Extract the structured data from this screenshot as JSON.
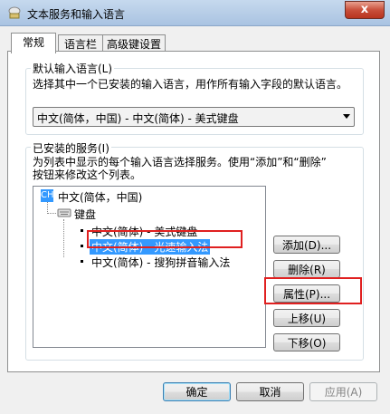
{
  "window": {
    "title": "文本服务和输入语言",
    "close_label": "x"
  },
  "tabs": [
    {
      "label": "常规",
      "active": true
    },
    {
      "label": "语言栏",
      "active": false
    },
    {
      "label": "高级键设置",
      "active": false
    }
  ],
  "default_language": {
    "group_label": "默认输入语言(L)",
    "description": "选择其中一个已安装的输入语言，用作所有输入字段的默认语言。",
    "selected": "中文(简体，中国) - 中文(简体) - 美式键盘"
  },
  "installed_services": {
    "group_label": "已安装的服务(I)",
    "description_line1": "为列表中显示的每个输入语言选择服务。使用“添加”和“删除”",
    "description_line2": "按钮来修改这个列表。",
    "tree": {
      "language_badge": "CH",
      "language": "中文(简体，中国)",
      "category": "键盘",
      "items": [
        {
          "label": "中文(简体) - 美式键盘",
          "selected": false
        },
        {
          "label": "中文(简体) - 光速输入法",
          "selected": true
        },
        {
          "label": "中文(简体) - 搜狗拼音输入法",
          "selected": false
        }
      ]
    },
    "buttons": {
      "add": "添加(D)...",
      "remove": "删除(R)",
      "properties": "属性(P)...",
      "move_up": "上移(U)",
      "move_down": "下移(O)"
    }
  },
  "footer": {
    "ok": "确定",
    "cancel": "取消",
    "apply": "应用(A)"
  },
  "colors": {
    "highlight_box": "#e02020",
    "selection": "#3399ff"
  }
}
